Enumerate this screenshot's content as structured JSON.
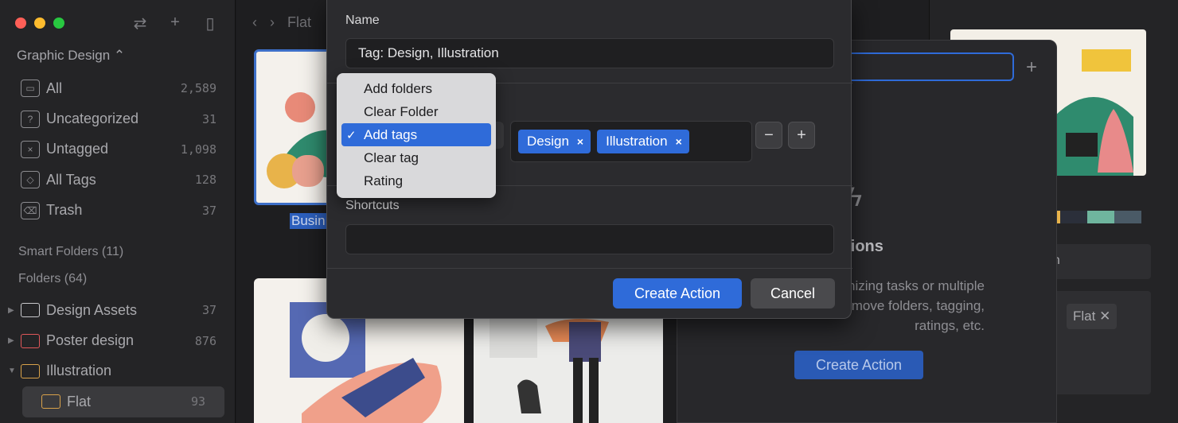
{
  "sidebar": {
    "library_title": "Graphic Design",
    "nav": [
      {
        "label": "All",
        "count": "2,589",
        "icon": "all-icon"
      },
      {
        "label": "Uncategorized",
        "count": "31",
        "icon": "uncategorized-icon"
      },
      {
        "label": "Untagged",
        "count": "1,098",
        "icon": "untagged-icon"
      },
      {
        "label": "All Tags",
        "count": "128",
        "icon": "tag-icon"
      },
      {
        "label": "Trash",
        "count": "37",
        "icon": "trash-icon"
      }
    ],
    "smart_folders": "Smart Folders (11)",
    "folders_title": "Folders (64)",
    "folders": [
      {
        "label": "Design Assets",
        "count": "37",
        "color": "#c9c9cc"
      },
      {
        "label": "Poster design",
        "count": "876",
        "color": "#e0575a"
      },
      {
        "label": "Illustration",
        "count": "",
        "color": "#d9a24a"
      },
      {
        "label": "Flat",
        "count": "93",
        "color": "#d9a24a"
      }
    ]
  },
  "main": {
    "breadcrumb": "Flat",
    "thumb_label": "Busin"
  },
  "right_panel": {
    "tag": "Flat",
    "field_text": "an",
    "palette": [
      "#e8b34a",
      "#2b2f3a",
      "#6fb59e",
      "#4a5a66"
    ]
  },
  "actions_panel": {
    "title": "ctions",
    "description": "orm serial organizing tasks or multiple files, such as add/move folders, tagging, ratings, etc.",
    "button": "Create Action"
  },
  "dialog": {
    "name_label": "Name",
    "name_value": "Tag: Design, Illustration",
    "tags": [
      "Design",
      "Illustration"
    ],
    "minus": "−",
    "plus": "+",
    "shortcuts_label": "Shortcuts",
    "shortcuts_value": "",
    "create_button": "Create Action",
    "cancel_button": "Cancel"
  },
  "dropdown": {
    "items": [
      "Add folders",
      "Clear Folder",
      "Add tags",
      "Clear tag",
      "Rating"
    ],
    "selected": "Add tags"
  }
}
